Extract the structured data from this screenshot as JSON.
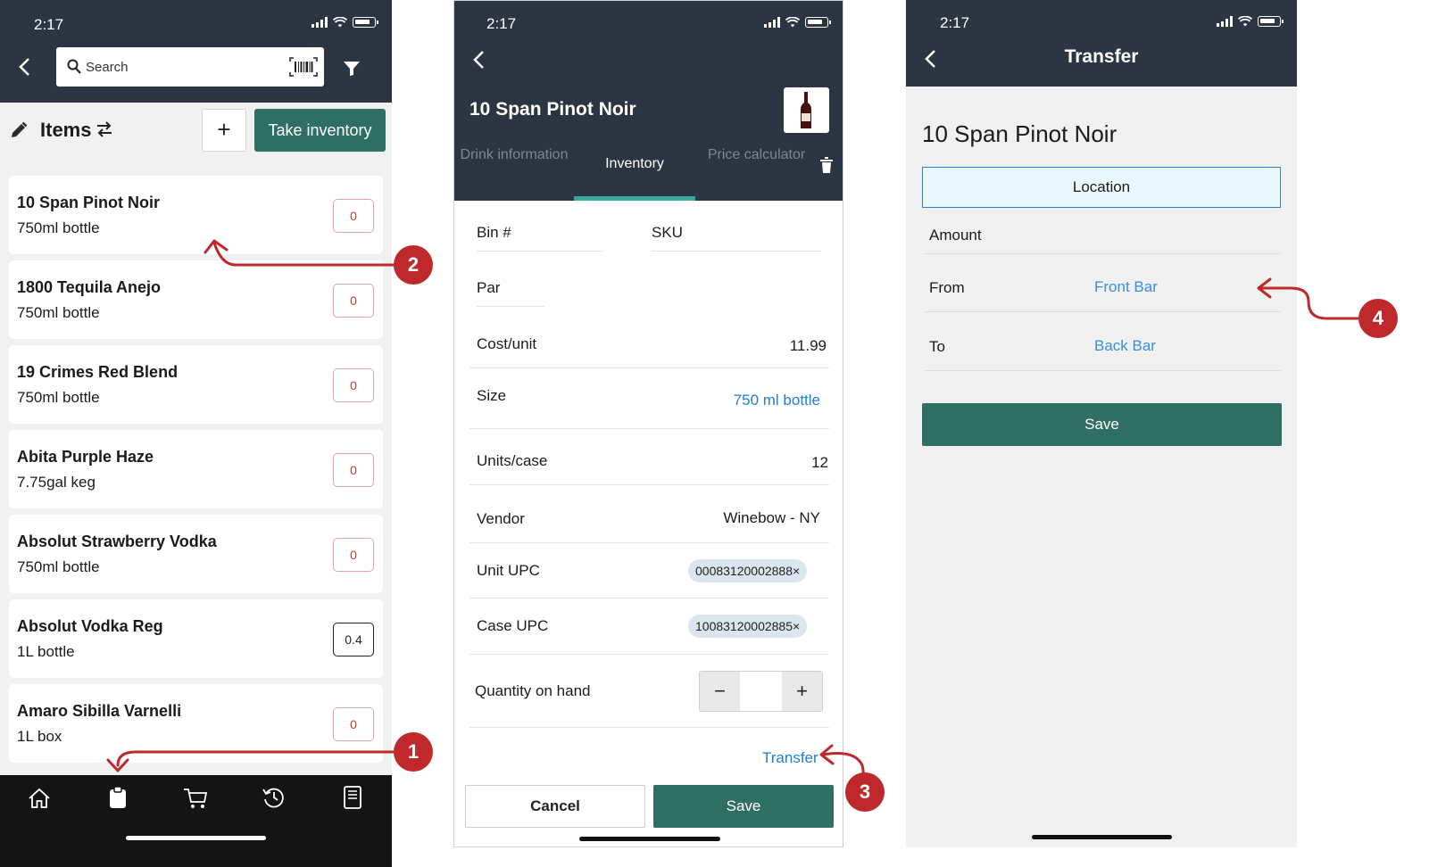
{
  "colors": {
    "header": "#2c3642",
    "accent_green": "#2f6e62",
    "link_blue": "#1f7fd1",
    "callout_red": "#c0292b",
    "qty_border_red": "#e8a3a3"
  },
  "status": {
    "time": "2:17"
  },
  "screen1": {
    "search_placeholder": "Search",
    "icons": [
      "back-icon",
      "search-icon",
      "barcode-icon",
      "filter-icon",
      "edit-icon",
      "swap-icon"
    ],
    "title": "Items",
    "add_label": "+",
    "take_inventory_label": "Take inventory",
    "items": [
      {
        "name": "10 Span Pinot Noir",
        "size": "750ml bottle",
        "qty": "0"
      },
      {
        "name": "1800 Tequila Anejo",
        "size": "750ml bottle",
        "qty": "0"
      },
      {
        "name": "19 Crimes Red Blend",
        "size": "750ml bottle",
        "qty": "0"
      },
      {
        "name": "Abita Purple Haze",
        "size": "7.75gal keg",
        "qty": "0"
      },
      {
        "name": "Absolut Strawberry Vodka",
        "size": "750ml bottle",
        "qty": "0"
      },
      {
        "name": "Absolut Vodka Reg",
        "size": "1L bottle",
        "qty": "0.4"
      },
      {
        "name": "Amaro Sibilla Varnelli",
        "size": "1L box",
        "qty": "0"
      }
    ],
    "tabbar_icons": [
      "home-icon",
      "clipboard-icon",
      "cart-icon",
      "history-icon",
      "book-icon"
    ]
  },
  "screen2": {
    "product_name": "10 Span Pinot Noir",
    "tabs": [
      "Drink information",
      "Inventory",
      "Price calculator"
    ],
    "active_tab": "Inventory",
    "fields": {
      "bin_label": "Bin #",
      "sku_label": "SKU",
      "par_label": "Par",
      "cost_label": "Cost/unit",
      "cost_value": "11.99",
      "size_label": "Size",
      "size_value": "750 ml bottle",
      "units_label": "Units/case",
      "units_value": "12",
      "vendor_label": "Vendor",
      "vendor_value": "Winebow - NY",
      "unit_upc_label": "Unit UPC",
      "unit_upc_value": "00083120002888",
      "case_upc_label": "Case UPC",
      "case_upc_value": "10083120002885",
      "qoh_label": "Quantity on hand",
      "minus": "−",
      "plus": "+"
    },
    "chip_close": "×",
    "transfer_link": "Transfer",
    "cancel_label": "Cancel",
    "save_label": "Save"
  },
  "screen3": {
    "title": "Transfer",
    "product_name": "10 Span Pinot Noir",
    "location_label": "Location",
    "amount_label": "Amount",
    "from_label": "From",
    "from_value": "Front Bar",
    "to_label": "To",
    "to_value": "Back Bar",
    "save_label": "Save"
  },
  "callouts": [
    "1",
    "2",
    "3",
    "4"
  ]
}
